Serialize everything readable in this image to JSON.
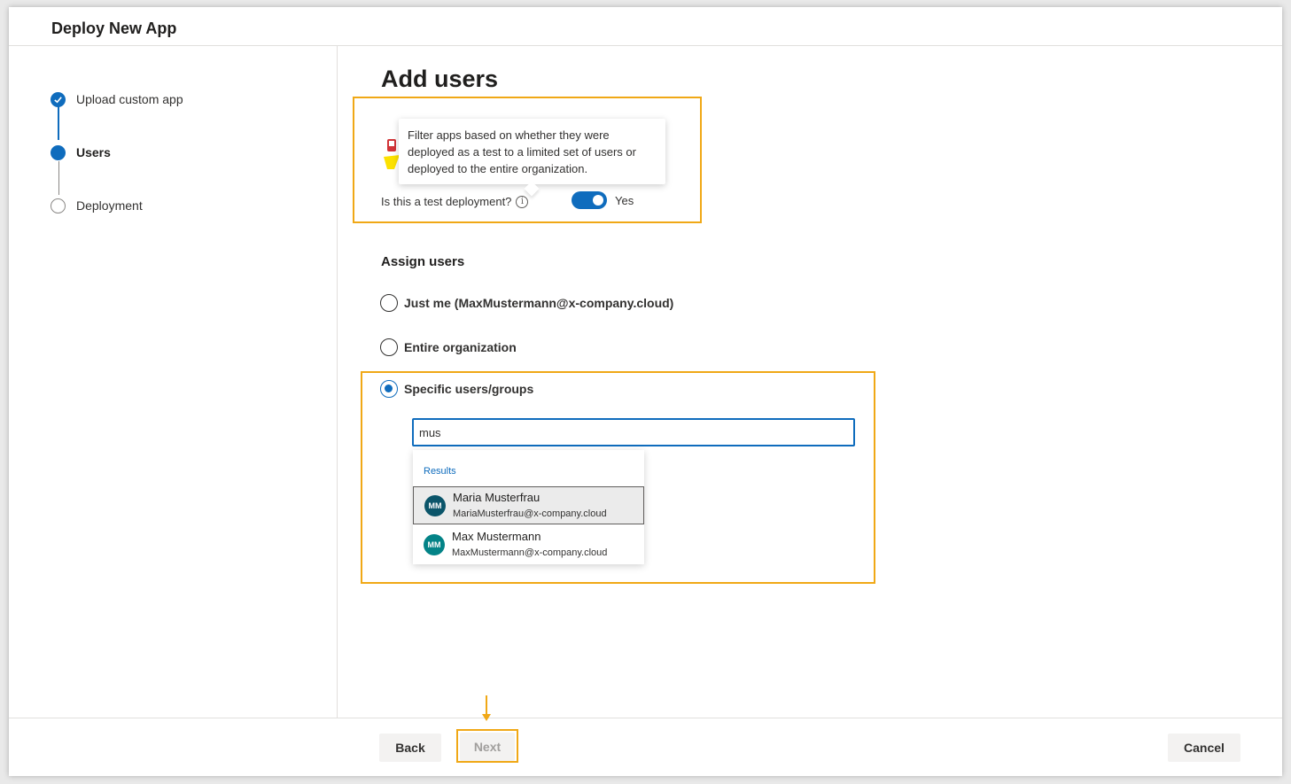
{
  "window": {
    "title": "Deploy New App"
  },
  "steps": [
    {
      "label": "Upload custom app",
      "status": "done"
    },
    {
      "label": "Users",
      "status": "current"
    },
    {
      "label": "Deployment",
      "status": "todo"
    }
  ],
  "page": {
    "title": "Add users"
  },
  "tooltip": {
    "text": "Filter apps based on whether they were deployed as a test to a limited set of users or deployed to the entire organization."
  },
  "test_deployment": {
    "label": "Is this a test deployment?",
    "toggle_value": "Yes",
    "enabled": true
  },
  "assign_users": {
    "title": "Assign users",
    "options": [
      {
        "label": "Just me (MaxMustermann@x-company.cloud)",
        "checked": false
      },
      {
        "label": "Entire organization",
        "checked": false
      },
      {
        "label": "Specific users/groups",
        "checked": true
      }
    ]
  },
  "search": {
    "value": "mus"
  },
  "results": {
    "header": "Results",
    "items": [
      {
        "initials": "MM",
        "name": "Maria Musterfrau",
        "email": "MariaMusterfrau@x-company.cloud",
        "color": "#0b556a"
      },
      {
        "initials": "MM",
        "name": "Max Mustermann",
        "email": "MaxMustermann@x-company.cloud",
        "color": "#038387"
      }
    ]
  },
  "footer": {
    "back": "Back",
    "next": "Next",
    "cancel": "Cancel"
  },
  "colors": {
    "accent": "#0f6cbd",
    "highlight": "#f0a816"
  }
}
